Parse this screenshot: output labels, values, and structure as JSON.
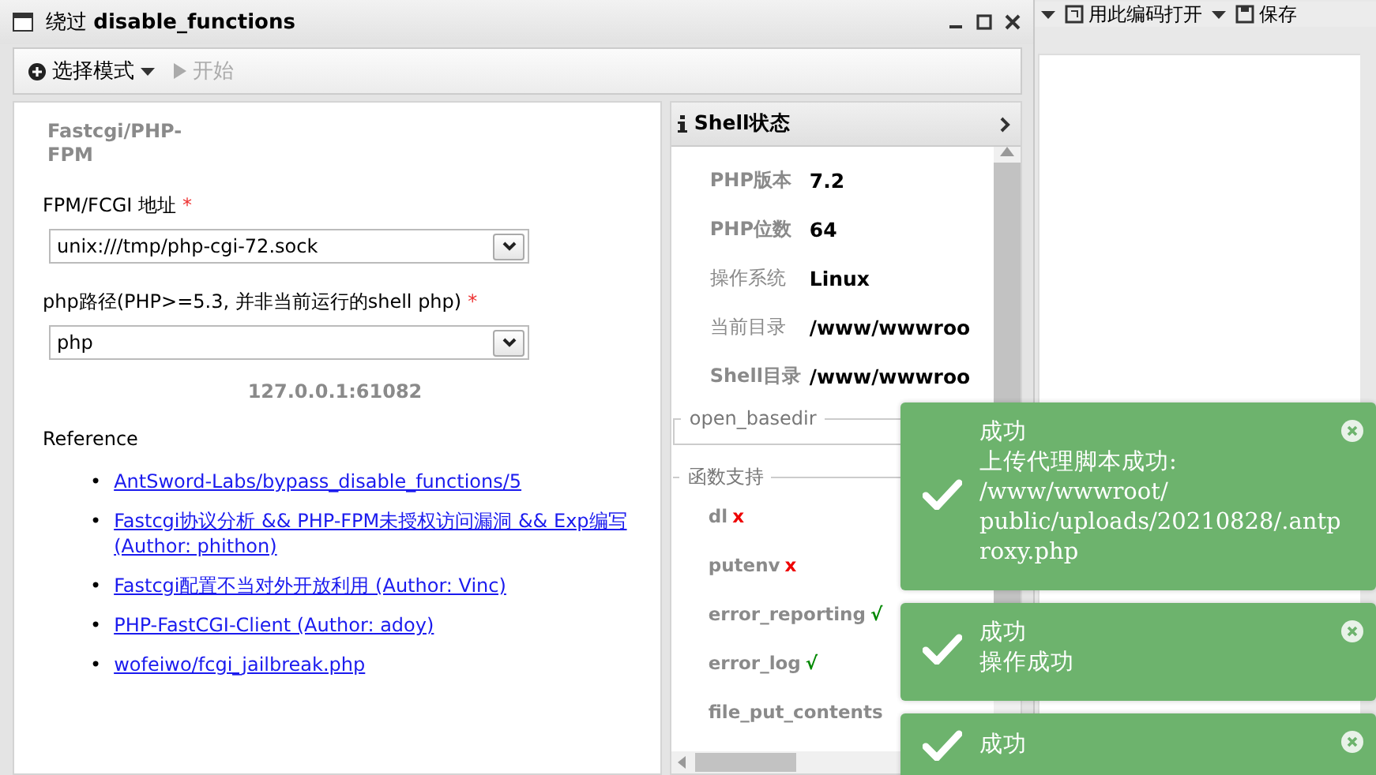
{
  "window": {
    "title": "绕过 disable_functions"
  },
  "toolbar": {
    "mode_button": "选择模式",
    "start_button": "开始",
    "start_disabled": true
  },
  "form": {
    "heading": "Fastcgi/PHP-FPM",
    "fields": [
      {
        "label": "FPM/FCGI 地址",
        "required_mark": "*",
        "value": "unix:///tmp/php-cgi-72.sock"
      },
      {
        "label": "php路径(PHP>=5.3, 并非当前运行的shell php)",
        "required_mark": "*",
        "value": "php"
      }
    ],
    "address": "127.0.0.1:61082",
    "reference_title": "Reference",
    "references": [
      {
        "bullet": "•",
        "text": "AntSword-Labs/bypass_disable_functions/5"
      },
      {
        "bullet": "•",
        "text": "Fastcgi协议分析 && PHP-FPM未授权访问漏洞 && Exp编写 (Author: phithon)"
      },
      {
        "bullet": "•",
        "text": "Fastcgi配置不当对外开放利用 (Author: Vinc)"
      },
      {
        "bullet": "•",
        "text": "PHP-FastCGI-Client (Author: adoy)"
      },
      {
        "bullet": "•",
        "text": "wofeiwo/fcgi_jailbreak.php"
      }
    ]
  },
  "shell_status": {
    "title": "Shell状态",
    "rows": [
      {
        "label": "PHP版本",
        "value": "7.2"
      },
      {
        "label": "PHP位数",
        "value": "64"
      },
      {
        "label": "操作系统",
        "value": "Linux"
      },
      {
        "label": "当前目录",
        "value": "/www/wwwroo"
      },
      {
        "label": "Shell目录",
        "value": "/www/wwwroo"
      }
    ],
    "open_basedir_title": "open_basedir",
    "functions_title": "函数支持",
    "functions": [
      {
        "name": "dl",
        "supported": false,
        "mark": "x"
      },
      {
        "name": "putenv",
        "supported": false,
        "mark": "x"
      },
      {
        "name": "error_reporting",
        "supported": true,
        "mark": "√"
      },
      {
        "name": "error_log",
        "supported": true,
        "mark": "√"
      },
      {
        "name": "file_put_contents"
      }
    ]
  },
  "background_toolbar": {
    "open_with_encoding": "用此编码打开",
    "save": "保存"
  },
  "toasts": [
    {
      "title": "成功",
      "lines": [
        "上传代理脚本成功:",
        "/www/wwwroot/",
        "public/uploads/20210828/.antproxy.php"
      ]
    },
    {
      "title": "成功",
      "lines": [
        "操作成功"
      ]
    },
    {
      "title": "成功"
    }
  ]
}
